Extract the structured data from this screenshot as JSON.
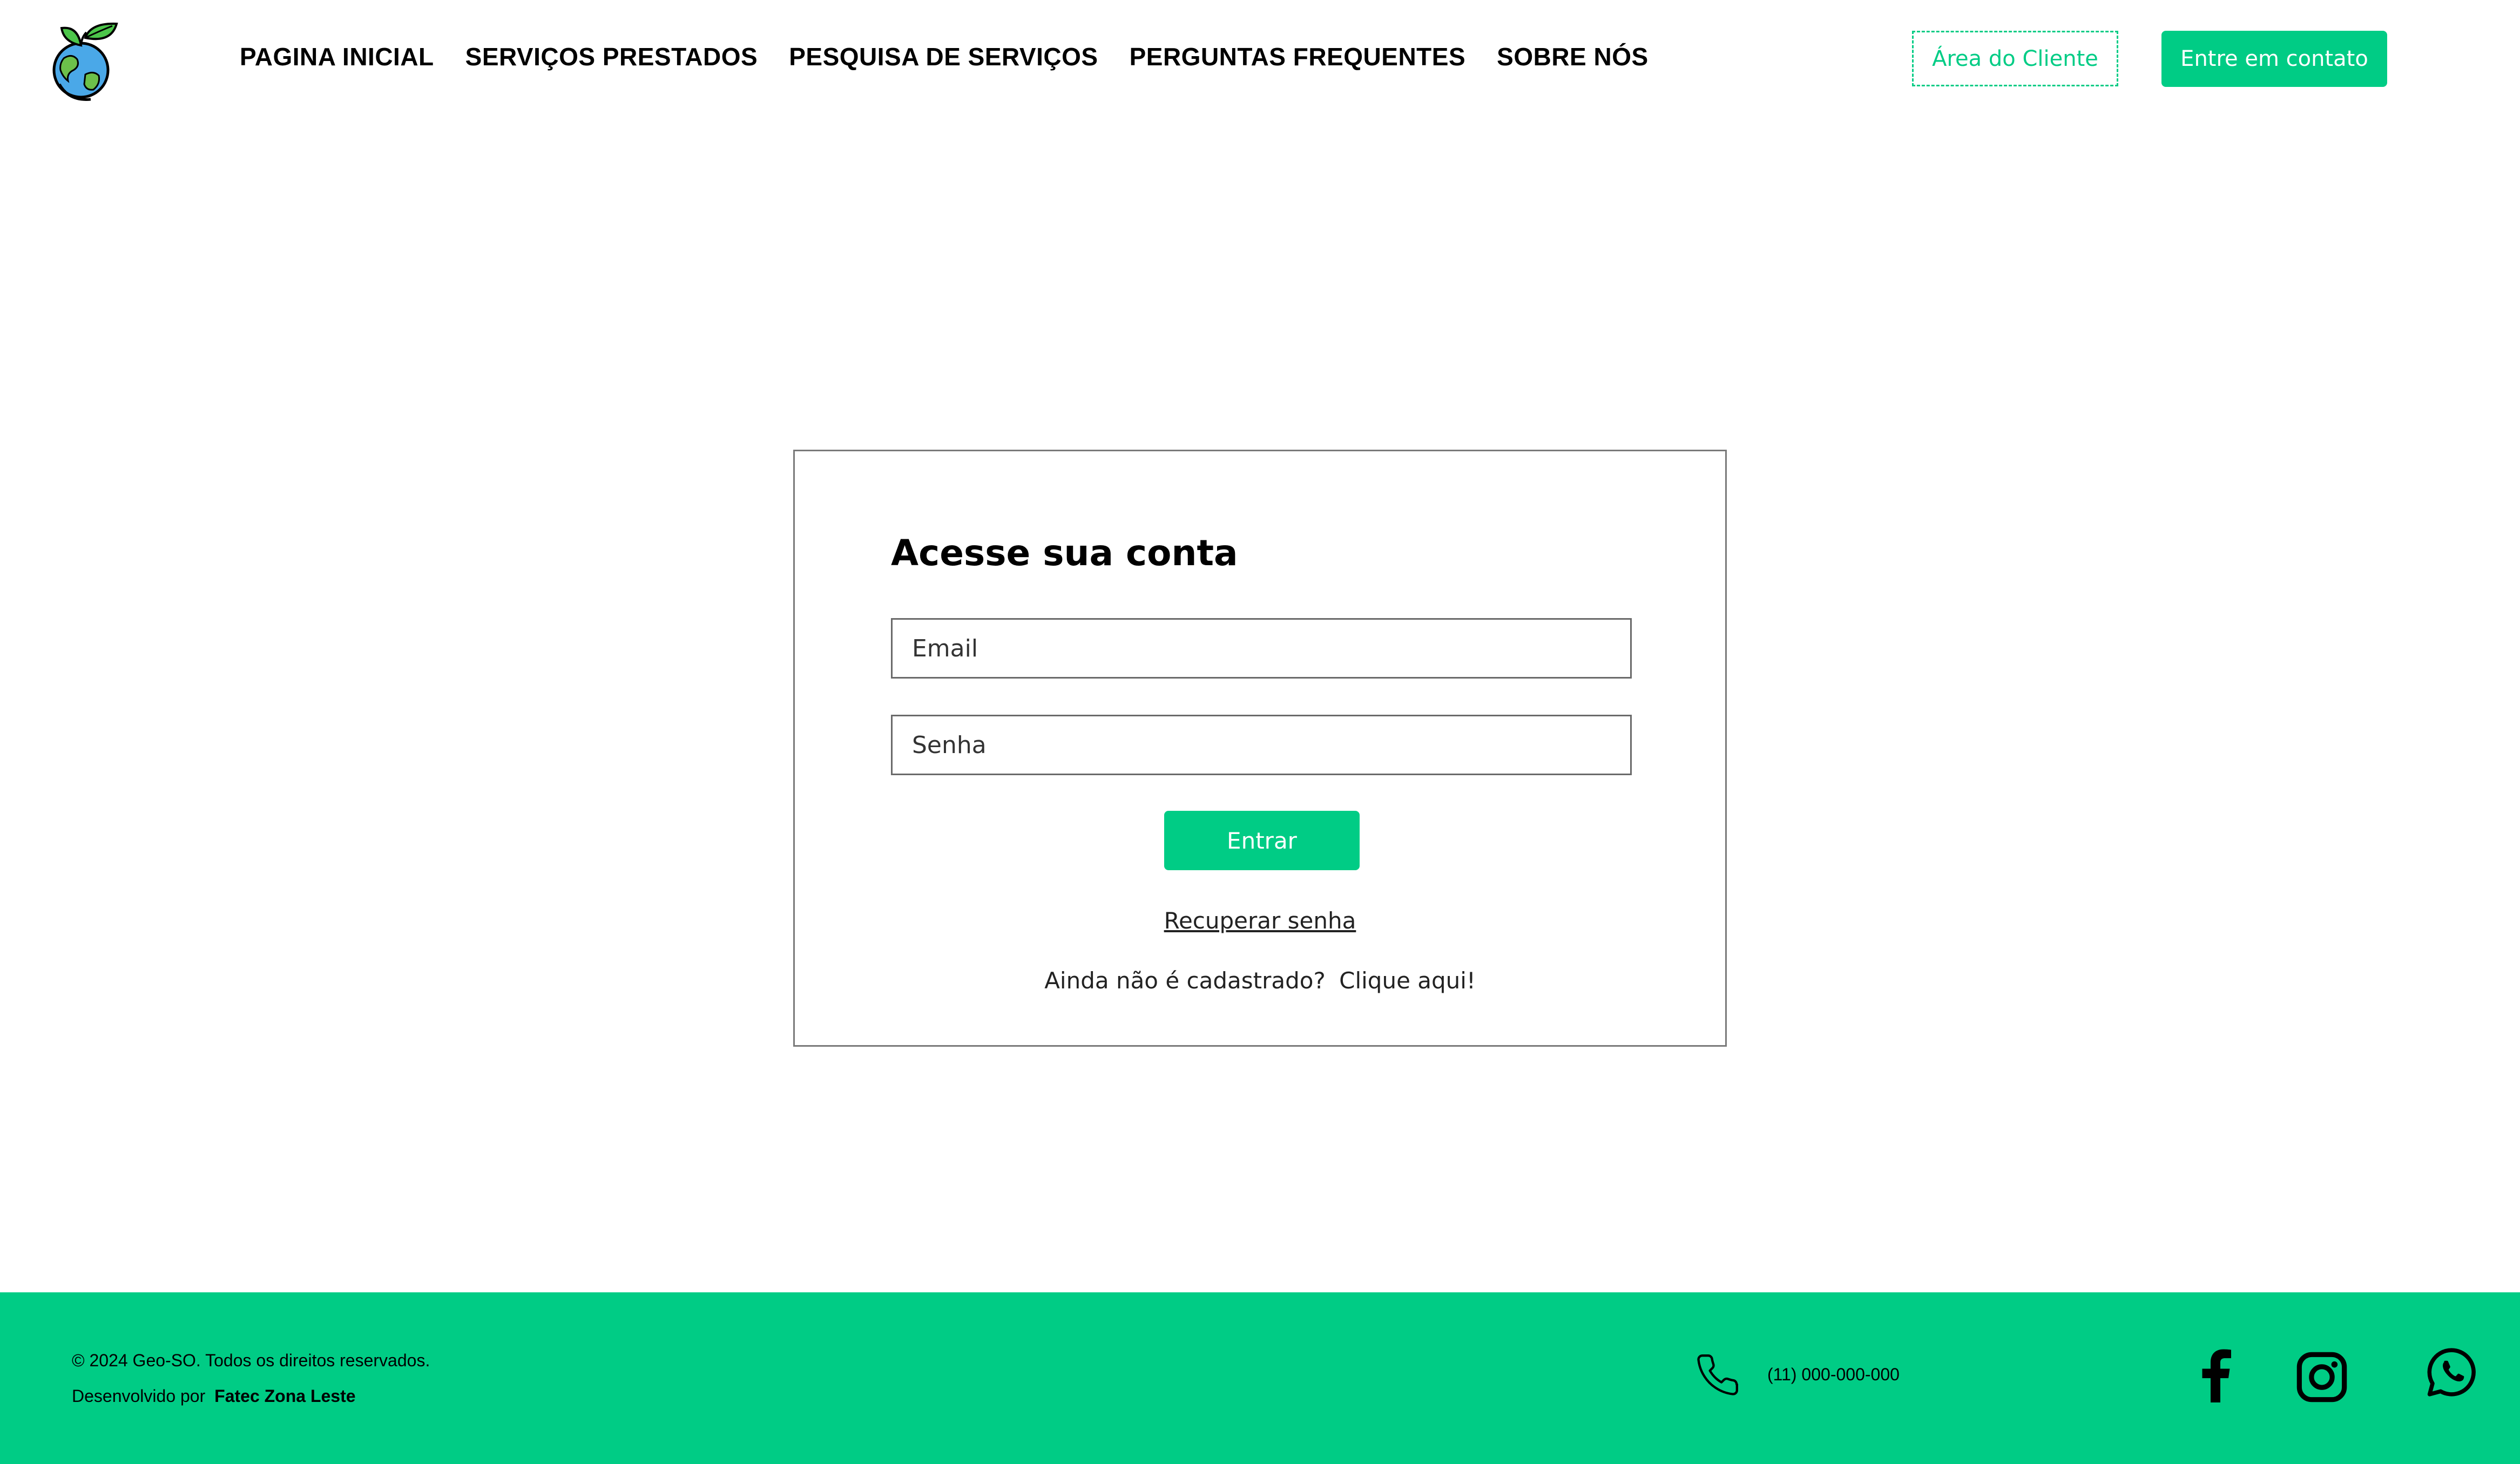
{
  "header": {
    "logo_alt": "Geo-SO",
    "nav": [
      {
        "label": "PAGINA INICIAL"
      },
      {
        "label": "SERVIÇOS PRESTADOS"
      },
      {
        "label": "PESQUISA DE SERVIÇOS"
      },
      {
        "label": "PERGUNTAS FREQUENTES"
      },
      {
        "label": "SOBRE NÓS"
      }
    ],
    "client_area_label": "Área do Cliente",
    "contact_label": "Entre em contato"
  },
  "login": {
    "title": "Acesse sua conta",
    "email_placeholder": "Email",
    "password_placeholder": "Senha",
    "submit_label": "Entrar",
    "recover_label": "Recuperar senha",
    "signup_prompt": "Ainda não é cadastrado?",
    "signup_link": "Clique aqui!"
  },
  "footer": {
    "copyright": "© 2024 Geo-SO. Todos os direitos reservados.",
    "developed_by_label": "Desenvolvido por",
    "developed_by_name": "Fatec Zona Leste",
    "phone": "(11) 000-000-000",
    "social": [
      "facebook-icon",
      "instagram-icon",
      "whatsapp-icon"
    ]
  },
  "colors": {
    "accent": "#00cc85",
    "border": "#7a7a7a"
  }
}
